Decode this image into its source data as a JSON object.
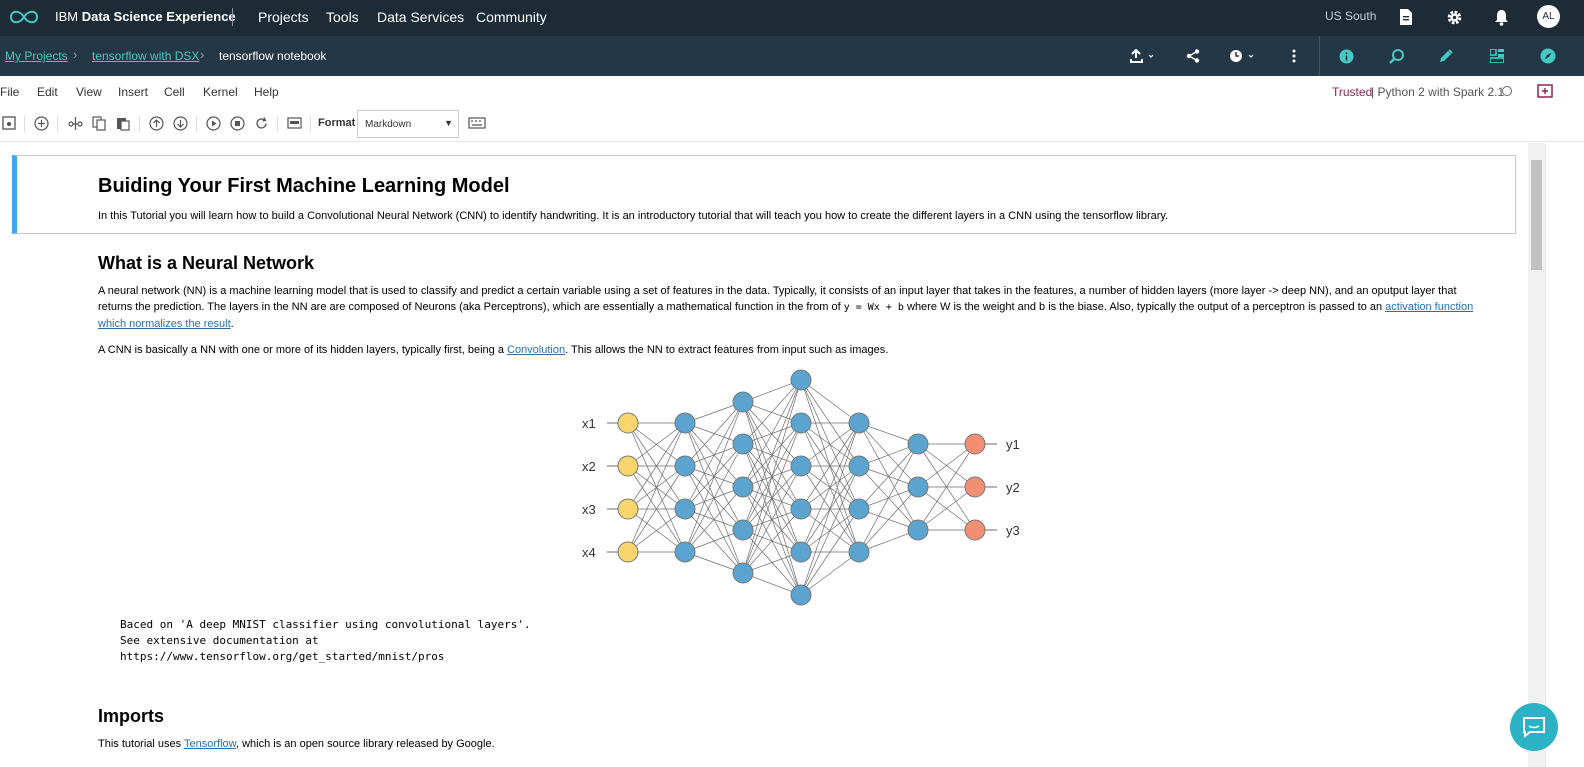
{
  "top_nav": {
    "brand_prefix": "IBM ",
    "brand_bold": "Data Science Experience",
    "items": [
      "Projects",
      "Tools",
      "Data Services",
      "Community"
    ],
    "region": "US South",
    "avatar": "AL",
    "icons": [
      "document-icon",
      "gear-icon",
      "bell-icon"
    ]
  },
  "breadcrumb": {
    "items": [
      "My Projects",
      "tensorflow with DSX",
      "tensorflow notebook"
    ]
  },
  "menu": {
    "items": [
      "File",
      "Edit",
      "View",
      "Insert",
      "Cell",
      "Kernel",
      "Help"
    ],
    "trusted": "Trusted",
    "kernel": "| Python 2 with Spark 2.1"
  },
  "toolbar": {
    "format_label": "Format",
    "format_value": "Markdown"
  },
  "notebook": {
    "title": "Buiding Your First Machine Learning Model",
    "intro": "In this Tutorial you will learn how to build a Convolutional Neural Network (CNN) to identify handwriting. It is an introductory tutorial that will teach you how to create the different layers in a CNN using the tensorflow library.",
    "nn_heading": "What is a Neural Network",
    "nn_p1_a": "A neural network (NN) is a machine learning model that is used to classify and predict a certain variable using a set of features in the data. Typically, it consists of an input layer that takes in the features, a number of hidden layers (more layer -> deep NN), and an oputput layer that returns the prediction. The layers in the NN are are composed of Neurons (aka Perceptrons), which are essentially a mathematical function in the from of ",
    "nn_p1_code": "y = Wx + b",
    "nn_p1_b": " where W is the weight and b is the biase. Also, typically the output of a perceptron is passed to an ",
    "nn_p1_link": "activation function which normalizes the result",
    "nn_p1_c": ".",
    "cnn_p_a": "A CNN is basically a NN with one or more of its hidden layers, typically first, being a ",
    "cnn_p_link": "Convolution",
    "cnn_p_b": ". This allows the NN to extract features from input such as images.",
    "diagram_inputs": [
      "x1",
      "x2",
      "x3",
      "x4"
    ],
    "diagram_outputs": [
      "y1",
      "y2",
      "y3"
    ],
    "pre_text": "Baced on 'A deep MNIST classifier using convolutional layers'.\nSee extensive documentation at\nhttps://www.tensorflow.org/get_started/mnist/pros",
    "imports_heading": "Imports",
    "imports_p_a": "This tutorial uses ",
    "imports_p_link": "Tensorflow",
    "imports_p_b": ", which is an open source library released by Google."
  },
  "colors": {
    "topbar": "#1d2b37",
    "subbar": "#243746",
    "accent": "#46c9c3",
    "input_node": "#f9d56e",
    "hidden_node": "#5ba4cf",
    "output_node": "#f28e73"
  }
}
